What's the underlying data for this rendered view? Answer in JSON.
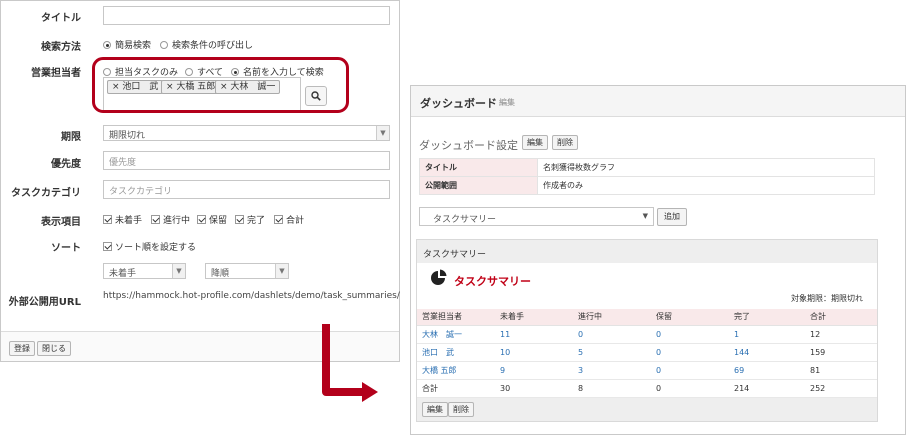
{
  "form": {
    "title_label": "タイトル",
    "title_value": "",
    "search_method_label": "検索方法",
    "search_method_options": [
      "簡易検索",
      "検索条件の呼び出し"
    ],
    "sales_rep_label": "営業担当者",
    "sales_rep_options": [
      "担当タスクのみ",
      "すべて",
      "名前を入力して検索"
    ],
    "sales_rep_tags": [
      "池口　武",
      "大橋 五郎",
      "大林　誠一"
    ],
    "period_label": "期限",
    "period_value": "期限切れ",
    "priority_label": "優先度",
    "priority_placeholder": "優先度",
    "category_label": "タスクカテゴリ",
    "category_placeholder": "タスクカテゴリ",
    "display_label": "表示項目",
    "display_items": [
      "未着手",
      "進行中",
      "保留",
      "完了",
      "合計"
    ],
    "sort_label": "ソート",
    "sort_checkbox": "ソート順を設定する",
    "sort_field": "未着手",
    "sort_order": "降順",
    "url_label": "外部公開用URL",
    "url_value": "https://hammock.hot-profile.com/dashlets/demo/task_summaries/",
    "save_button": "登録",
    "close_button": "閉じる"
  },
  "colors": {
    "highlight": "#b3001b",
    "arrow": "#b3001b",
    "summary_title": "#c00016",
    "link": "#2a6fb2",
    "label_bg": "#f9e9ea"
  },
  "dashboard": {
    "title": "ダッシュボード",
    "edit_link": "編集",
    "settings_title": "ダッシュボード設定",
    "edit_button": "編集",
    "delete_button": "削除",
    "info": [
      {
        "label": "タイトル",
        "value": "名刺獲得枚数グラフ"
      },
      {
        "label": "公開範囲",
        "value": "作成者のみ"
      }
    ],
    "widget_select": "タスクサマリー",
    "add_button": "追加",
    "summary_header": "タスクサマリー",
    "summary_title": "タスクサマリー",
    "period_text": "対象期限：期限切れ",
    "table": {
      "columns": [
        "営業担当者",
        "未着手",
        "進行中",
        "保留",
        "完了",
        "合計"
      ],
      "rows": [
        [
          "大林　誠一",
          "11",
          "0",
          "0",
          "1",
          "12"
        ],
        [
          "池口　武",
          "10",
          "5",
          "0",
          "144",
          "159"
        ],
        [
          "大橋 五郎",
          "9",
          "3",
          "0",
          "69",
          "81"
        ],
        [
          "合計",
          "30",
          "8",
          "0",
          "214",
          "252"
        ]
      ]
    },
    "footer_edit": "編集",
    "footer_delete": "削除"
  }
}
